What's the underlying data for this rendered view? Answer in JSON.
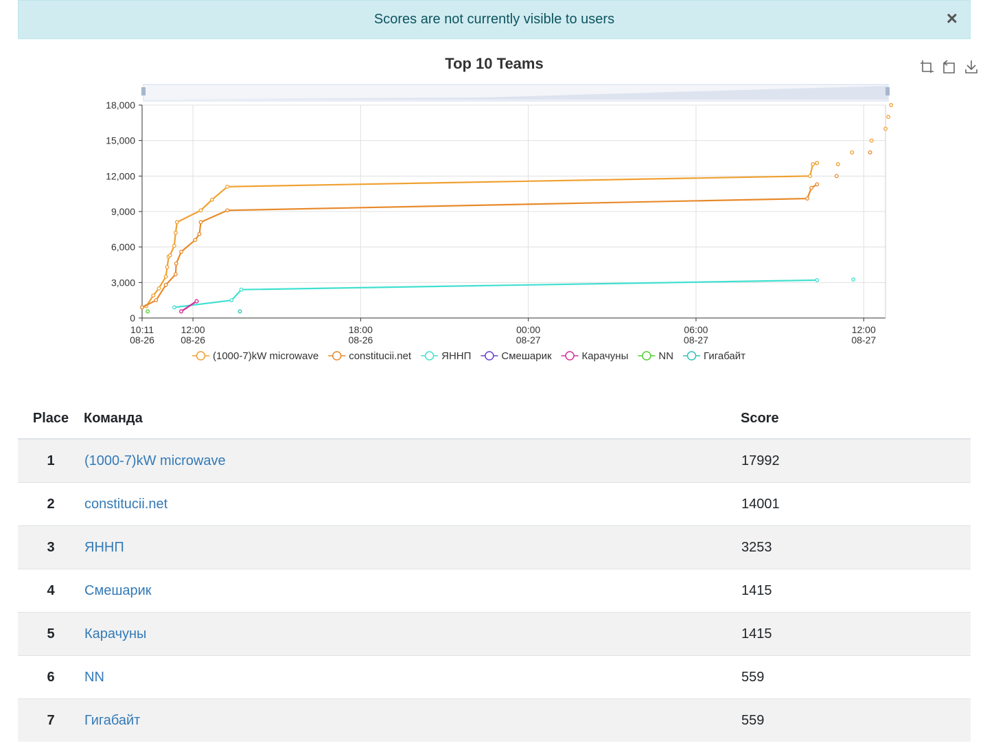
{
  "alert": {
    "message": "Scores are not currently visible to users",
    "close_label": "×"
  },
  "toolbox": {
    "icons": [
      "zoom-icon",
      "restore-icon",
      "download-icon"
    ]
  },
  "chart_data": {
    "type": "line",
    "title": "Top 10 Teams",
    "ylim": [
      0,
      18000
    ],
    "yticks": [
      "0",
      "3,000",
      "6,000",
      "9,000",
      "12,000",
      "15,000",
      "18,000"
    ],
    "xticks": [
      {
        "t": 0,
        "label": [
          "10:11",
          "08-26"
        ]
      },
      {
        "t": 1.82,
        "label": [
          "12:00",
          "08-26"
        ]
      },
      {
        "t": 7.82,
        "label": [
          "18:00",
          "08-26"
        ]
      },
      {
        "t": 13.82,
        "label": [
          "00:00",
          "08-27"
        ]
      },
      {
        "t": 19.82,
        "label": [
          "06:00",
          "08-27"
        ]
      },
      {
        "t": 25.82,
        "label": [
          "12:00",
          "08-27"
        ]
      }
    ],
    "xlim_hours": [
      0,
      26.6
    ],
    "grid": true,
    "legend_placement": "bottom",
    "series": [
      {
        "name": "(1000-7)kW microwave",
        "color": "#f0a030",
        "points": [
          [
            0,
            900
          ],
          [
            0.15,
            1000
          ],
          [
            0.4,
            1900
          ],
          [
            0.6,
            2500
          ],
          [
            0.85,
            3500
          ],
          [
            0.9,
            4300
          ],
          [
            0.95,
            5200
          ],
          [
            1.0,
            5300
          ],
          [
            1.15,
            6100
          ],
          [
            1.2,
            7200
          ],
          [
            1.25,
            8100
          ],
          [
            2.1,
            9100
          ],
          [
            2.5,
            10000
          ],
          [
            3.05,
            11100
          ],
          [
            23.9,
            12000
          ],
          [
            24.0,
            13000
          ],
          [
            24.15,
            13100
          ],
          [
            24.15,
            13100
          ]
        ],
        "tail": [
          [
            24.9,
            13000
          ],
          [
            25.4,
            14000
          ],
          [
            26.1,
            15000
          ],
          [
            26.6,
            16000
          ],
          [
            26.7,
            17000
          ],
          [
            26.8,
            18000
          ]
        ]
      },
      {
        "name": "constitucii.net",
        "color": "#e8892a",
        "points": [
          [
            0,
            900
          ],
          [
            0.5,
            1500
          ],
          [
            0.85,
            2800
          ],
          [
            1.2,
            3700
          ],
          [
            1.22,
            4600
          ],
          [
            1.4,
            5600
          ],
          [
            1.9,
            6600
          ],
          [
            2.05,
            7100
          ],
          [
            2.1,
            8100
          ],
          [
            3.05,
            9100
          ],
          [
            23.8,
            10100
          ],
          [
            23.95,
            11000
          ],
          [
            24.15,
            11300
          ]
        ],
        "tail": [
          [
            24.85,
            12000
          ],
          [
            26.05,
            14000
          ]
        ]
      },
      {
        "name": "ЯННП",
        "color": "#40e0d0",
        "points": [
          [
            1.15,
            900
          ],
          [
            3.2,
            1500
          ],
          [
            3.55,
            2400
          ],
          [
            24.15,
            3200
          ]
        ],
        "tail": [
          [
            25.45,
            3253
          ]
        ]
      },
      {
        "name": "Смешарик",
        "color": "#6a3fd0",
        "points": [
          [
            1.4,
            559
          ],
          [
            1.95,
            1415
          ]
        ],
        "tail": []
      },
      {
        "name": "Карачуны",
        "color": "#d9309a",
        "points": [
          [
            1.4,
            559
          ],
          [
            1.95,
            1415
          ]
        ],
        "tail": []
      },
      {
        "name": "NN",
        "color": "#50d030",
        "points": [
          [
            0.2,
            559
          ]
        ],
        "tail": []
      },
      {
        "name": "Гигабайт",
        "color": "#2ec4b6",
        "points": [
          [
            3.5,
            559
          ]
        ],
        "tail": []
      }
    ]
  },
  "table": {
    "headers": {
      "place": "Place",
      "team": "Команда",
      "score": "Score"
    },
    "rows": [
      {
        "place": "1",
        "team": "(1000-7)kW microwave",
        "score": "17992"
      },
      {
        "place": "2",
        "team": "constitucii.net",
        "score": "14001"
      },
      {
        "place": "3",
        "team": "ЯННП",
        "score": "3253"
      },
      {
        "place": "4",
        "team": "Смешарик",
        "score": "1415"
      },
      {
        "place": "5",
        "team": "Карачуны",
        "score": "1415"
      },
      {
        "place": "6",
        "team": "NN",
        "score": "559"
      },
      {
        "place": "7",
        "team": "Гигабайт",
        "score": "559"
      }
    ]
  }
}
